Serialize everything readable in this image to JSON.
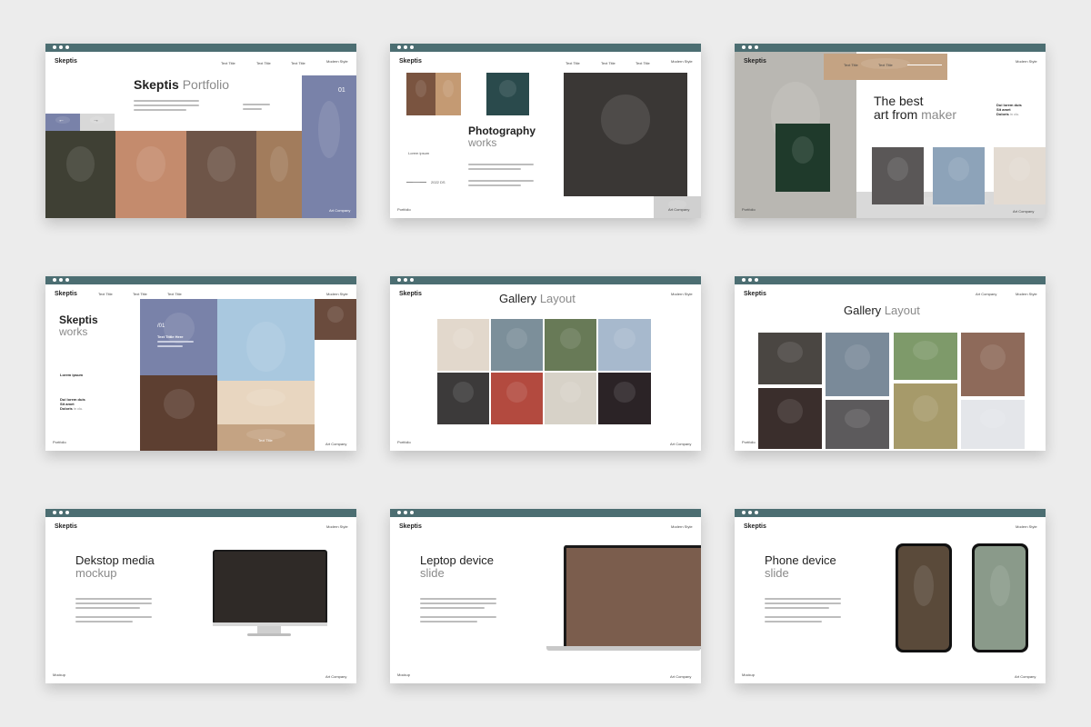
{
  "colors": {
    "topbar": "#4c6e72",
    "accent_blue": "#7982a9",
    "accent_tan": "#c4a383",
    "gray_text": "#8a8a8a"
  },
  "slides": [
    {
      "brand": "Skeptis",
      "nav": [
        "Text Title",
        "Text Title",
        "Text Title"
      ],
      "style": "Modern Style",
      "title": "Skeptis",
      "title_acc": "Portfolio",
      "number": "01",
      "footer": "Art Company"
    },
    {
      "brand": "Skeptis",
      "nav": [
        "Text Title",
        "Text Title",
        "Text Title"
      ],
      "style": "Modern Style",
      "title": "Photography",
      "title_acc": "works",
      "lorem": "Lorem ipsum",
      "date": "2022 DS",
      "footer_left": "Portfolio",
      "footer": "Art Company"
    },
    {
      "brand": "Skeptis",
      "nav": [
        "Text Title",
        "Text Title"
      ],
      "style": "Modern Style",
      "title": "The best",
      "title_line2": "art from",
      "title_acc": "maker",
      "side1": "Dui lorem duis",
      "side2": "Sit amet",
      "side3": "Doloris",
      "side3_acc": "in clu.",
      "footer_left": "Portfolio",
      "footer": "Art Company"
    },
    {
      "brand": "Skeptis",
      "nav": [
        "Text Title",
        "Text Title",
        "Text Title"
      ],
      "style": "Modern Style",
      "title": "Skeptis",
      "title_acc": "works",
      "lorem": "Lorem ipsum",
      "side1": "Dui lorem duis",
      "side2": "Sit amet",
      "side3": "Doloris",
      "side3_acc": "in clu.",
      "index": "/01",
      "panel_title": "Text Tittle Here",
      "tan_text": "Text Title",
      "footer_left": "Portfolio",
      "footer": "Art Company"
    },
    {
      "brand": "Skeptis",
      "style": "Modern Style",
      "title": "Gallery",
      "title_acc": "Layout",
      "footer_left": "Portfolio",
      "footer": "Art Company"
    },
    {
      "brand": "Skeptis",
      "nav": [
        "Art Company"
      ],
      "style": "Modern Style",
      "title": "Gallery",
      "title_acc": "Layout",
      "footer_left": "Portfolio"
    },
    {
      "brand": "Skeptis",
      "style": "Modern Style",
      "title": "Dekstop media",
      "title_acc": "mockup",
      "footer_left": "Mockup",
      "footer": "Art Company"
    },
    {
      "brand": "Skeptis",
      "style": "Modern Style",
      "title": "Leptop device",
      "title_acc": "slide",
      "footer_left": "Mockup",
      "footer": "Art Company"
    },
    {
      "brand": "Skeptis",
      "style": "Modern Style",
      "title": "Phone device",
      "title_acc": "slide",
      "footer_left": "Mockup",
      "footer": "Art Company"
    }
  ]
}
